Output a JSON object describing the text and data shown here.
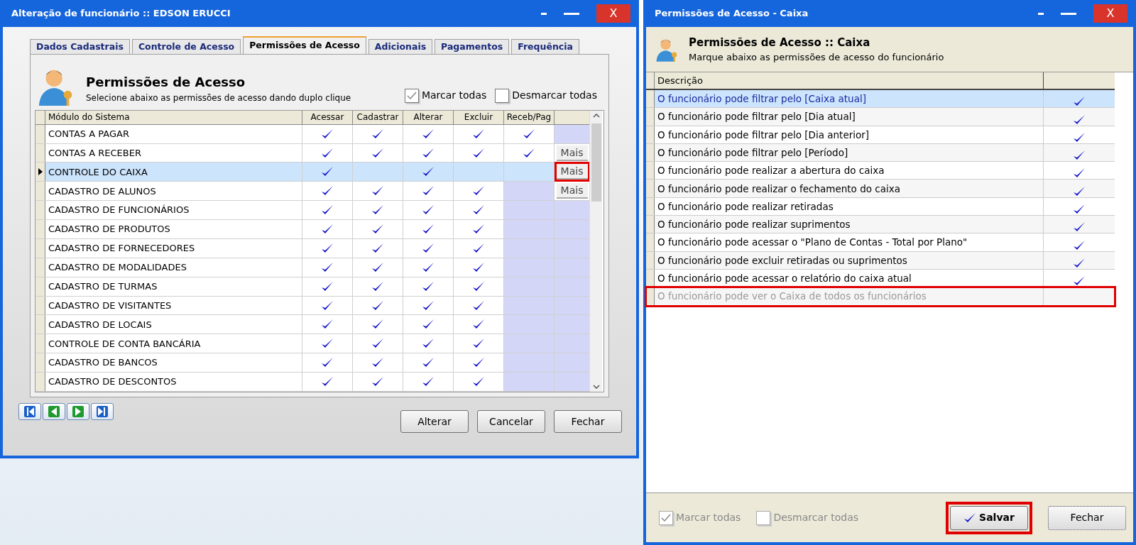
{
  "main_window": {
    "title": "Alteração de funcionário :: EDSON ERUCCI",
    "close": "X",
    "tabs": [
      {
        "label": "Dados Cadastrais",
        "selected": false
      },
      {
        "label": "Controle de Acesso",
        "selected": false
      },
      {
        "label": "Permissões de Acesso",
        "selected": true
      },
      {
        "label": "Adicionais",
        "selected": false
      },
      {
        "label": "Pagamentos",
        "selected": false
      },
      {
        "label": "Frequência",
        "selected": false
      }
    ],
    "heading": "Permissões de Acesso",
    "subtitle": "Selecione abaixo as permissões de acesso dando duplo clique",
    "mark_all": {
      "label": "Marcar todas",
      "checked": true
    },
    "unmark_all": {
      "label": "Desmarcar todas",
      "checked": false
    },
    "table": {
      "columns": [
        "Módulo do Sistema",
        "Acessar",
        "Cadastrar",
        "Alterar",
        "Excluir",
        "Receb/Pag"
      ],
      "rows": [
        {
          "module": "CONTAS A PAGAR",
          "checks": [
            true,
            true,
            true,
            true,
            true
          ],
          "receb_pag_enabled": true,
          "selected": false,
          "mais": null
        },
        {
          "module": "CONTAS A RECEBER",
          "checks": [
            true,
            true,
            true,
            true,
            true
          ],
          "receb_pag_enabled": true,
          "selected": false,
          "mais": {
            "label": "Mais",
            "highlighted": false
          }
        },
        {
          "module": "CONTROLE DO CAIXA",
          "checks": [
            true,
            false,
            true,
            false,
            false
          ],
          "receb_pag_enabled": false,
          "selected": true,
          "mais": {
            "label": "Mais",
            "highlighted": true
          }
        },
        {
          "module": "CADASTRO DE ALUNOS",
          "checks": [
            true,
            true,
            true,
            true,
            false
          ],
          "receb_pag_enabled": false,
          "selected": false,
          "mais": {
            "label": "Mais",
            "highlighted": false
          }
        },
        {
          "module": "CADASTRO DE FUNCIONÁRIOS",
          "checks": [
            true,
            true,
            true,
            true,
            false
          ],
          "receb_pag_enabled": false,
          "selected": false,
          "mais": null
        },
        {
          "module": "CADASTRO DE PRODUTOS",
          "checks": [
            true,
            true,
            true,
            true,
            false
          ],
          "receb_pag_enabled": false,
          "selected": false,
          "mais": null
        },
        {
          "module": "CADASTRO DE FORNECEDORES",
          "checks": [
            true,
            true,
            true,
            true,
            false
          ],
          "receb_pag_enabled": false,
          "selected": false,
          "mais": null
        },
        {
          "module": "CADASTRO DE MODALIDADES",
          "checks": [
            true,
            true,
            true,
            true,
            false
          ],
          "receb_pag_enabled": false,
          "selected": false,
          "mais": null
        },
        {
          "module": "CADASTRO DE TURMAS",
          "checks": [
            true,
            true,
            true,
            true,
            false
          ],
          "receb_pag_enabled": false,
          "selected": false,
          "mais": null
        },
        {
          "module": "CADASTRO DE VISITANTES",
          "checks": [
            true,
            true,
            true,
            true,
            false
          ],
          "receb_pag_enabled": false,
          "selected": false,
          "mais": null
        },
        {
          "module": "CADASTRO DE LOCAIS",
          "checks": [
            true,
            true,
            true,
            true,
            false
          ],
          "receb_pag_enabled": false,
          "selected": false,
          "mais": null
        },
        {
          "module": "CONTROLE DE CONTA BANCÁRIA",
          "checks": [
            true,
            true,
            true,
            true,
            false
          ],
          "receb_pag_enabled": false,
          "selected": false,
          "mais": null
        },
        {
          "module": "CADASTRO DE BANCOS",
          "checks": [
            true,
            true,
            true,
            true,
            false
          ],
          "receb_pag_enabled": false,
          "selected": false,
          "mais": null
        },
        {
          "module": "CADASTRO DE DESCONTOS",
          "checks": [
            true,
            true,
            true,
            true,
            false
          ],
          "receb_pag_enabled": false,
          "selected": false,
          "mais": null
        }
      ]
    },
    "nav_buttons": [
      {
        "kind": "first"
      },
      {
        "kind": "prev"
      },
      {
        "kind": "next"
      },
      {
        "kind": "last"
      }
    ],
    "buttons": [
      "Alterar",
      "Cancelar",
      "Fechar"
    ]
  },
  "caixa_window": {
    "title": "Permissões de Acesso - Caixa",
    "close": "X",
    "heading": "Permissões de Acesso :: Caixa",
    "subtitle": "Marque abaixo as permissões de acesso do funcionário",
    "column": "Descrição",
    "rows": [
      {
        "text": "O funcionário pode filtrar pelo [Caixa atual]",
        "checked": true,
        "selected": true,
        "disabled": false,
        "highlighted": false
      },
      {
        "text": "O funcionário pode filtrar pelo [Dia atual]",
        "checked": true,
        "selected": false,
        "disabled": false,
        "highlighted": false
      },
      {
        "text": "O funcionário pode filtrar pelo [Dia anterior]",
        "checked": true,
        "selected": false,
        "disabled": false,
        "highlighted": false
      },
      {
        "text": "O funcionário pode filtrar pelo [Período]",
        "checked": true,
        "selected": false,
        "disabled": false,
        "highlighted": false
      },
      {
        "text": "O funcionário pode realizar a abertura do caixa",
        "checked": true,
        "selected": false,
        "disabled": false,
        "highlighted": false
      },
      {
        "text": "O funcionário pode realizar o fechamento do caixa",
        "checked": true,
        "selected": false,
        "disabled": false,
        "highlighted": false
      },
      {
        "text": "O funcionário pode realizar retiradas",
        "checked": true,
        "selected": false,
        "disabled": false,
        "highlighted": false
      },
      {
        "text": "O funcionário pode realizar suprimentos",
        "checked": true,
        "selected": false,
        "disabled": false,
        "highlighted": false
      },
      {
        "text": "O funcionário pode acessar o \"Plano de Contas - Total por Plano\"",
        "checked": true,
        "selected": false,
        "disabled": false,
        "highlighted": false
      },
      {
        "text": "O funcionário pode excluir retiradas ou suprimentos",
        "checked": true,
        "selected": false,
        "disabled": false,
        "highlighted": false
      },
      {
        "text": "O funcionário pode acessar o relatório do caixa atual",
        "checked": true,
        "selected": false,
        "disabled": false,
        "highlighted": false
      },
      {
        "text": "O funcionário pode ver o Caixa de todos os funcionários",
        "checked": false,
        "selected": false,
        "disabled": true,
        "highlighted": true
      }
    ],
    "mark_all": {
      "label": "Marcar todas",
      "checked": true,
      "disabled": true
    },
    "unmark_all": {
      "label": "Desmarcar todas",
      "checked": false,
      "disabled": true
    },
    "save": {
      "label": "Salvar",
      "highlighted": true
    },
    "close_button": "Fechar"
  }
}
